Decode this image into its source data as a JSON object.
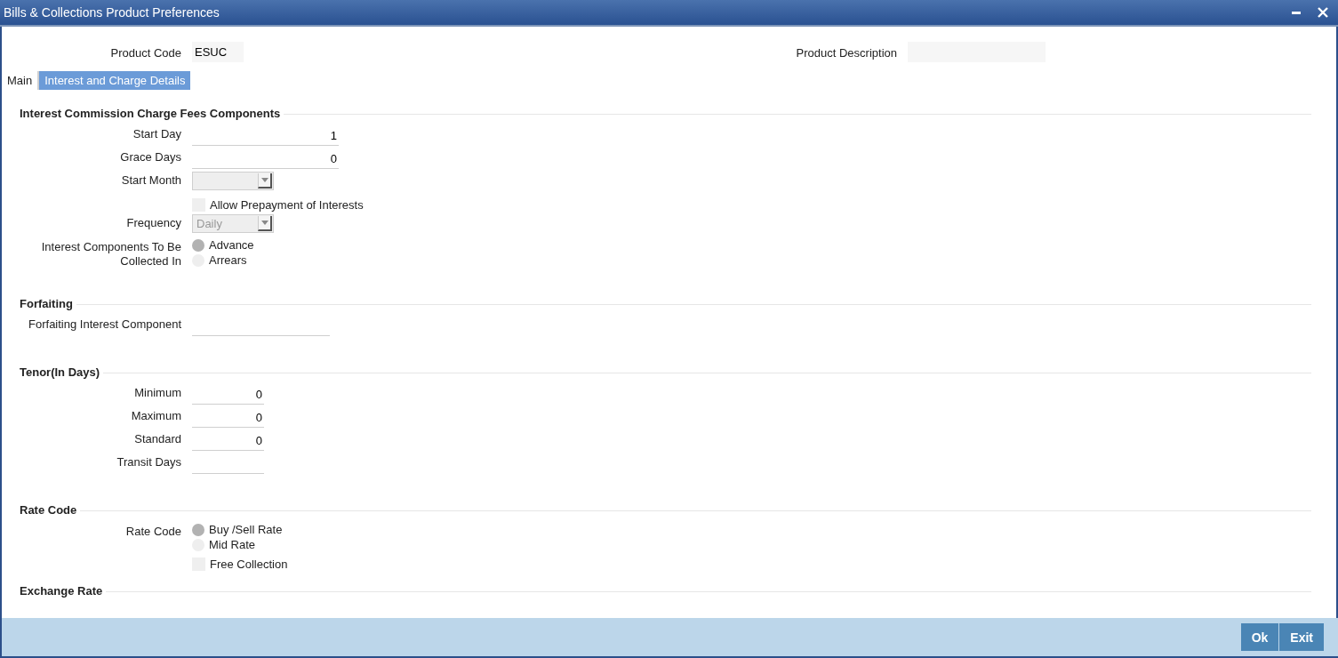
{
  "window": {
    "title": "Bills & Collections Product Preferences"
  },
  "header": [
    {
      "label": "Product Code",
      "value": "ESUC"
    },
    {
      "label": "Product Description"
    }
  ],
  "tabs": [
    {
      "label": "Main",
      "selected": false
    },
    {
      "label": "Interest and Charge Details",
      "selected": true
    }
  ],
  "sections": [
    {
      "title": "Interest Commission Charge Fees Components",
      "rows": [
        {
          "kind": "text",
          "label": "Start Day",
          "value": "1"
        },
        {
          "kind": "text",
          "label": "Grace Days",
          "value": "0"
        },
        {
          "kind": "select",
          "label": "Start Month"
        },
        {
          "kind": "checkbox",
          "text": "Allow Prepayment of Interests",
          "checked": false
        },
        {
          "kind": "select",
          "label": "Frequency",
          "value": "Daily"
        },
        {
          "kind": "radio",
          "label": "Interest Components To Be Collected In",
          "options": [
            {
              "text": "Advance",
              "selected": true
            },
            {
              "text": "Arrears",
              "selected": false
            }
          ]
        }
      ]
    },
    {
      "title": "Forfaiting",
      "rows": [
        {
          "kind": "text",
          "label": "Forfaiting Interest Component"
        }
      ]
    },
    {
      "title": "Tenor(In Days)",
      "rows": [
        {
          "kind": "text",
          "label": "Minimum",
          "value": "0"
        },
        {
          "kind": "text",
          "label": "Maximum",
          "value": "0"
        },
        {
          "kind": "text",
          "label": "Standard",
          "value": "0"
        },
        {
          "kind": "text",
          "label": "Transit Days"
        }
      ]
    },
    {
      "title": "Rate Code",
      "rows": [
        {
          "kind": "radio",
          "label": "Rate Code",
          "options": [
            {
              "text": "Buy /Sell Rate",
              "selected": true
            },
            {
              "text": "Mid Rate",
              "selected": false
            }
          ]
        },
        {
          "kind": "checkbox",
          "text": "Free Collection",
          "checked": false
        }
      ]
    },
    {
      "title": "Exchange Rate"
    }
  ],
  "buttons": [
    "Ok",
    "Exit"
  ]
}
